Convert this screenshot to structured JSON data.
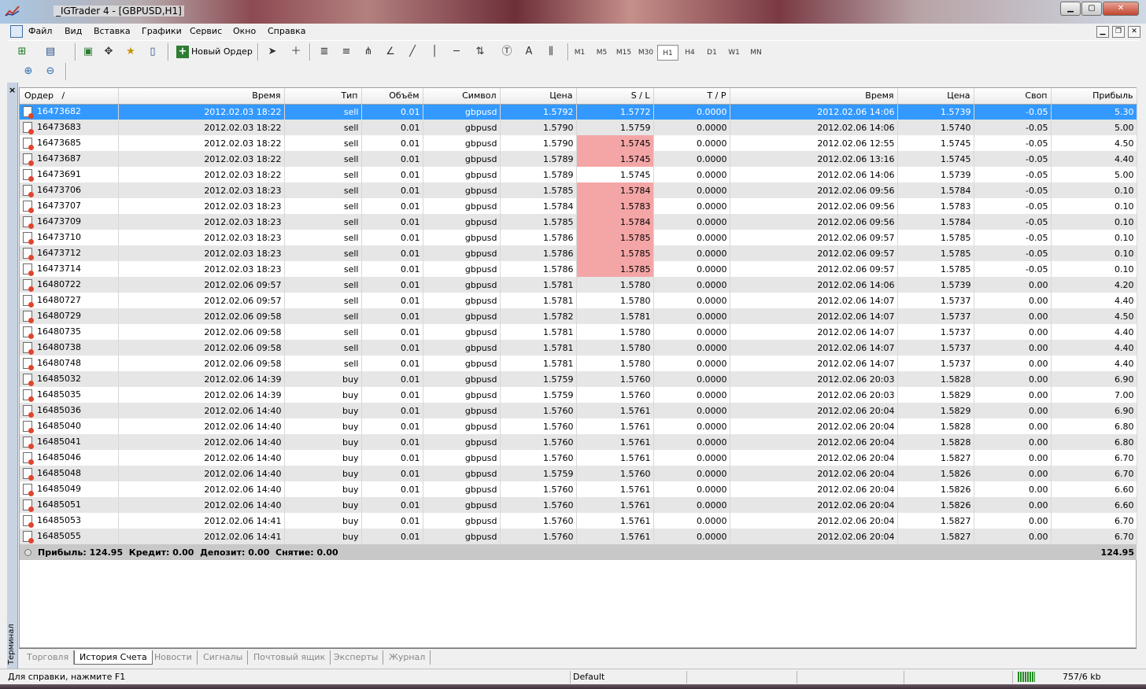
{
  "window": {
    "title": "_IGTrader 4 - [GBPUSD,H1]"
  },
  "menu": [
    "Файл",
    "Вид",
    "Вставка",
    "Графики",
    "Сервис",
    "Окно",
    "Справка"
  ],
  "toolbar": {
    "new_order_label": "Новый Ордер",
    "timeframes": [
      "M1",
      "M5",
      "M15",
      "M30",
      "H1",
      "H4",
      "D1",
      "W1",
      "MN"
    ],
    "active_timeframe": "H1",
    "text_tool": "A"
  },
  "table": {
    "columns": [
      "Ордер",
      "/",
      "Время",
      "Тип",
      "Объём",
      "Символ",
      "Цена",
      "S / L",
      "T / P",
      "Время",
      "Цена",
      "Своп",
      "Прибыль"
    ],
    "rows": [
      [
        "16473682",
        "2012.02.03 18:22",
        "sell",
        "0.01",
        "gbpusd",
        "1.5792",
        "1.5772",
        "0.0000",
        "2012.02.06 14:06",
        "1.5739",
        "-0.05",
        "5.30"
      ],
      [
        "16473683",
        "2012.02.03 18:22",
        "sell",
        "0.01",
        "gbpusd",
        "1.5790",
        "1.5759",
        "0.0000",
        "2012.02.06 14:06",
        "1.5740",
        "-0.05",
        "5.00"
      ],
      [
        "16473685",
        "2012.02.03 18:22",
        "sell",
        "0.01",
        "gbpusd",
        "1.5790",
        "1.5745",
        "0.0000",
        "2012.02.06 12:55",
        "1.5745",
        "-0.05",
        "4.50"
      ],
      [
        "16473687",
        "2012.02.03 18:22",
        "sell",
        "0.01",
        "gbpusd",
        "1.5789",
        "1.5745",
        "0.0000",
        "2012.02.06 13:16",
        "1.5745",
        "-0.05",
        "4.40"
      ],
      [
        "16473691",
        "2012.02.03 18:22",
        "sell",
        "0.01",
        "gbpusd",
        "1.5789",
        "1.5745",
        "0.0000",
        "2012.02.06 14:06",
        "1.5739",
        "-0.05",
        "5.00"
      ],
      [
        "16473706",
        "2012.02.03 18:23",
        "sell",
        "0.01",
        "gbpusd",
        "1.5785",
        "1.5784",
        "0.0000",
        "2012.02.06 09:56",
        "1.5784",
        "-0.05",
        "0.10"
      ],
      [
        "16473707",
        "2012.02.03 18:23",
        "sell",
        "0.01",
        "gbpusd",
        "1.5784",
        "1.5783",
        "0.0000",
        "2012.02.06 09:56",
        "1.5783",
        "-0.05",
        "0.10"
      ],
      [
        "16473709",
        "2012.02.03 18:23",
        "sell",
        "0.01",
        "gbpusd",
        "1.5785",
        "1.5784",
        "0.0000",
        "2012.02.06 09:56",
        "1.5784",
        "-0.05",
        "0.10"
      ],
      [
        "16473710",
        "2012.02.03 18:23",
        "sell",
        "0.01",
        "gbpusd",
        "1.5786",
        "1.5785",
        "0.0000",
        "2012.02.06 09:57",
        "1.5785",
        "-0.05",
        "0.10"
      ],
      [
        "16473712",
        "2012.02.03 18:23",
        "sell",
        "0.01",
        "gbpusd",
        "1.5786",
        "1.5785",
        "0.0000",
        "2012.02.06 09:57",
        "1.5785",
        "-0.05",
        "0.10"
      ],
      [
        "16473714",
        "2012.02.03 18:23",
        "sell",
        "0.01",
        "gbpusd",
        "1.5786",
        "1.5785",
        "0.0000",
        "2012.02.06 09:57",
        "1.5785",
        "-0.05",
        "0.10"
      ],
      [
        "16480722",
        "2012.02.06 09:57",
        "sell",
        "0.01",
        "gbpusd",
        "1.5781",
        "1.5780",
        "0.0000",
        "2012.02.06 14:06",
        "1.5739",
        "0.00",
        "4.20"
      ],
      [
        "16480727",
        "2012.02.06 09:57",
        "sell",
        "0.01",
        "gbpusd",
        "1.5781",
        "1.5780",
        "0.0000",
        "2012.02.06 14:07",
        "1.5737",
        "0.00",
        "4.40"
      ],
      [
        "16480729",
        "2012.02.06 09:58",
        "sell",
        "0.01",
        "gbpusd",
        "1.5782",
        "1.5781",
        "0.0000",
        "2012.02.06 14:07",
        "1.5737",
        "0.00",
        "4.50"
      ],
      [
        "16480735",
        "2012.02.06 09:58",
        "sell",
        "0.01",
        "gbpusd",
        "1.5781",
        "1.5780",
        "0.0000",
        "2012.02.06 14:07",
        "1.5737",
        "0.00",
        "4.40"
      ],
      [
        "16480738",
        "2012.02.06 09:58",
        "sell",
        "0.01",
        "gbpusd",
        "1.5781",
        "1.5780",
        "0.0000",
        "2012.02.06 14:07",
        "1.5737",
        "0.00",
        "4.40"
      ],
      [
        "16480748",
        "2012.02.06 09:58",
        "sell",
        "0.01",
        "gbpusd",
        "1.5781",
        "1.5780",
        "0.0000",
        "2012.02.06 14:07",
        "1.5737",
        "0.00",
        "4.40"
      ],
      [
        "16485032",
        "2012.02.06 14:39",
        "buy",
        "0.01",
        "gbpusd",
        "1.5759",
        "1.5760",
        "0.0000",
        "2012.02.06 20:03",
        "1.5828",
        "0.00",
        "6.90"
      ],
      [
        "16485035",
        "2012.02.06 14:39",
        "buy",
        "0.01",
        "gbpusd",
        "1.5759",
        "1.5760",
        "0.0000",
        "2012.02.06 20:03",
        "1.5829",
        "0.00",
        "7.00"
      ],
      [
        "16485036",
        "2012.02.06 14:40",
        "buy",
        "0.01",
        "gbpusd",
        "1.5760",
        "1.5761",
        "0.0000",
        "2012.02.06 20:04",
        "1.5829",
        "0.00",
        "6.90"
      ],
      [
        "16485040",
        "2012.02.06 14:40",
        "buy",
        "0.01",
        "gbpusd",
        "1.5760",
        "1.5761",
        "0.0000",
        "2012.02.06 20:04",
        "1.5828",
        "0.00",
        "6.80"
      ],
      [
        "16485041",
        "2012.02.06 14:40",
        "buy",
        "0.01",
        "gbpusd",
        "1.5760",
        "1.5761",
        "0.0000",
        "2012.02.06 20:04",
        "1.5828",
        "0.00",
        "6.80"
      ],
      [
        "16485046",
        "2012.02.06 14:40",
        "buy",
        "0.01",
        "gbpusd",
        "1.5760",
        "1.5761",
        "0.0000",
        "2012.02.06 20:04",
        "1.5827",
        "0.00",
        "6.70"
      ],
      [
        "16485048",
        "2012.02.06 14:40",
        "buy",
        "0.01",
        "gbpusd",
        "1.5759",
        "1.5760",
        "0.0000",
        "2012.02.06 20:04",
        "1.5826",
        "0.00",
        "6.70"
      ],
      [
        "16485049",
        "2012.02.06 14:40",
        "buy",
        "0.01",
        "gbpusd",
        "1.5760",
        "1.5761",
        "0.0000",
        "2012.02.06 20:04",
        "1.5826",
        "0.00",
        "6.60"
      ],
      [
        "16485051",
        "2012.02.06 14:40",
        "buy",
        "0.01",
        "gbpusd",
        "1.5760",
        "1.5761",
        "0.0000",
        "2012.02.06 20:04",
        "1.5826",
        "0.00",
        "6.60"
      ],
      [
        "16485053",
        "2012.02.06 14:41",
        "buy",
        "0.01",
        "gbpusd",
        "1.5760",
        "1.5761",
        "0.0000",
        "2012.02.06 20:04",
        "1.5827",
        "0.00",
        "6.70"
      ],
      [
        "16485055",
        "2012.02.06 14:41",
        "buy",
        "0.01",
        "gbpusd",
        "1.5760",
        "1.5761",
        "0.0000",
        "2012.02.06 20:04",
        "1.5827",
        "0.00",
        "6.70"
      ]
    ],
    "selected_row": 0,
    "sl_highlight_rows": [
      2,
      3,
      5,
      6,
      7,
      8,
      9,
      10
    ],
    "summary_text": "Прибыль: 124.95  Кредит: 0.00  Депозит: 0.00  Снятие: 0.00",
    "summary_total": "124.95"
  },
  "tabs": [
    "Торговля",
    "История Счета",
    "Новости",
    "Сигналы",
    "Почтовый ящик",
    "Эксперты",
    "Журнал"
  ],
  "active_tab": "История Счета",
  "terminal_label": "Терминал",
  "status": {
    "help": "Для справки, нажмите F1",
    "profile": "Default",
    "traffic": "757/6 kb"
  },
  "colors": {
    "selected_row": "#3399ff",
    "sl_highlight": "#f4a5a5",
    "row_alt": "#e6e6e6"
  }
}
